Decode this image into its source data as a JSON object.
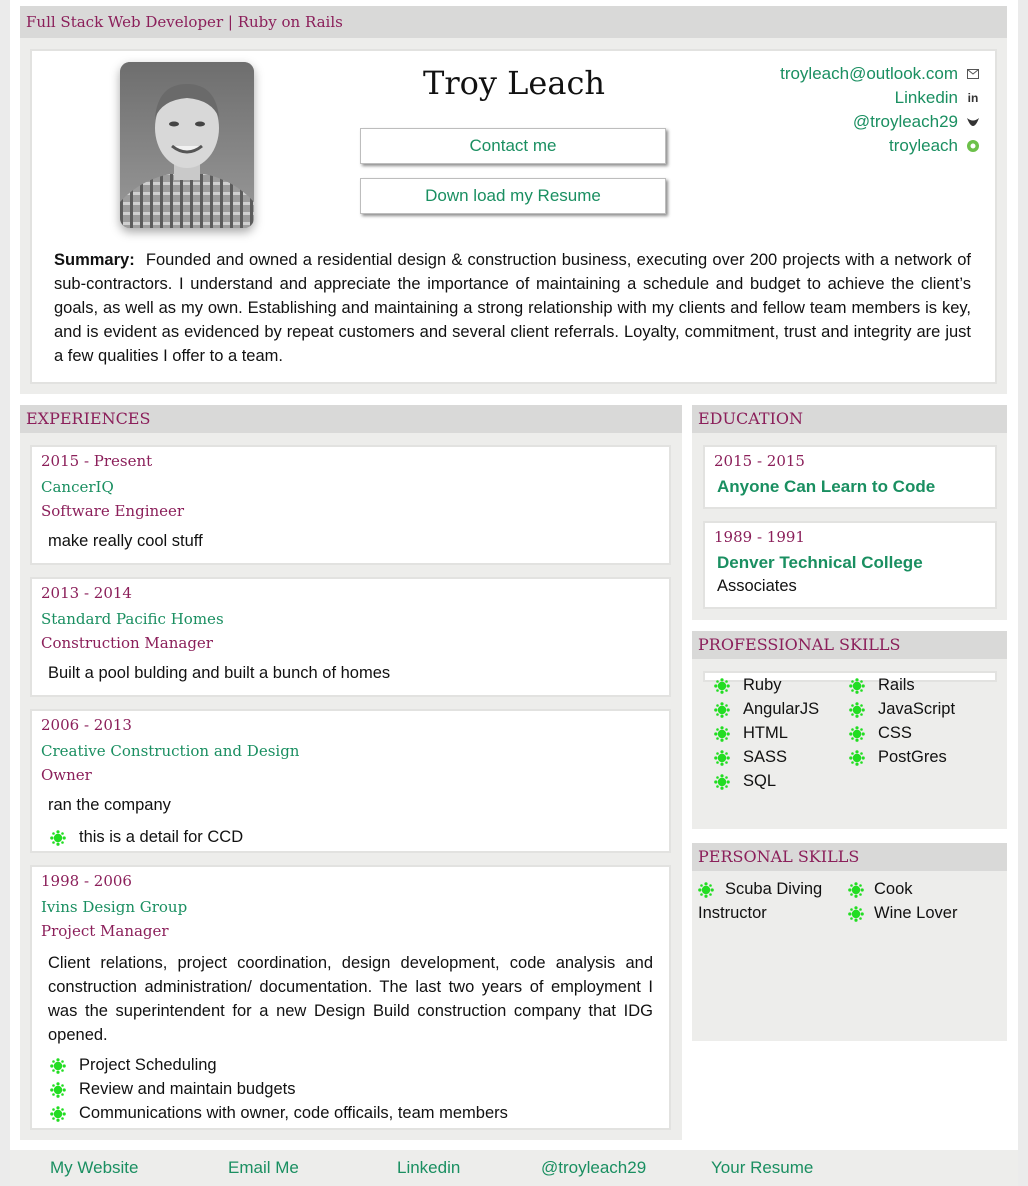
{
  "topbar": {
    "title": "Full Stack Web Developer | Ruby on Rails"
  },
  "header": {
    "name": "Troy Leach",
    "contact_button": "Contact me",
    "resume_button": "Down load my Resume",
    "contacts": [
      {
        "label": "troyleach@outlook.com",
        "icon": "mail-icon"
      },
      {
        "label": "Linkedin",
        "icon": "linkedin-icon"
      },
      {
        "label": "@troyleach29",
        "icon": "twitter-icon"
      },
      {
        "label": "troyleach",
        "icon": "github-icon"
      }
    ],
    "summary_label": "Summary:",
    "summary_text": "Founded and owned a residential design & construction business, executing over 200 projects with a network of sub-contractors. I understand and appreciate the importance of maintaining a schedule and budget to achieve the client’s goals, as well as my own. Establishing and maintaining a strong relationship with my clients and fellow team members is key, and is evident as evidenced by repeat customers and several client referrals. Loyalty, commitment, trust and integrity are just a few qualities I offer to a team."
  },
  "experiences": {
    "title": "EXPERIENCES",
    "items": [
      {
        "years": "2015 - Present",
        "company": "CancerIQ",
        "role": "Software Engineer",
        "description": "make really cool stuff",
        "details": []
      },
      {
        "years": "2013 - 2014",
        "company": "Standard Pacific Homes",
        "role": "Construction Manager",
        "description": "Built a pool bulding and built a bunch of homes",
        "details": []
      },
      {
        "years": "2006 - 2013",
        "company": "Creative Construction and Design",
        "role": "Owner",
        "description": "ran the company",
        "details": [
          "this is a detail for CCD"
        ]
      },
      {
        "years": "1998 - 2006",
        "company": "Ivins Design Group",
        "role": "Project Manager",
        "description": "Client relations, project coordination, design development, code analysis and construction administration/ documentation. The last two years of employment I was the superintendent for a new Design Build construction company that IDG opened.",
        "details": [
          "Project Scheduling",
          "Review and maintain budgets",
          "Communications with owner, code officails, team members"
        ]
      }
    ]
  },
  "education": {
    "title": "EDUCATION",
    "items": [
      {
        "years": "2015 - 2015",
        "school": "Anyone Can Learn to Code",
        "degree": ""
      },
      {
        "years": "1989 - 1991",
        "school": "Denver Technical College",
        "degree": "Associates"
      }
    ]
  },
  "professional_skills": {
    "title": "PROFESSIONAL SKILLS",
    "left": [
      "Ruby",
      "AngularJS",
      "HTML",
      "SASS",
      "SQL"
    ],
    "right": [
      "Rails",
      "JavaScript",
      "CSS",
      "PostGres"
    ]
  },
  "personal_skills": {
    "title": "PERSONAL SKILLS",
    "left": [
      "Scuba Diving",
      "Instructor"
    ],
    "right": [
      "Cook",
      "Wine Lover"
    ]
  },
  "footer": {
    "links": [
      "My Website",
      "Email Me",
      "Linkedin",
      "@troyleach29",
      "Your Resume"
    ]
  },
  "colors": {
    "accent": "#1a8f61",
    "heading": "#8b1f5a",
    "bullet": "#22dd22",
    "bar": "#d9d9d8"
  }
}
